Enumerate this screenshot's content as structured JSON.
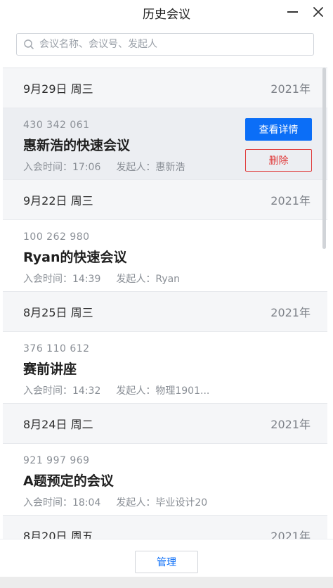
{
  "window": {
    "title": "历史会议"
  },
  "search": {
    "placeholder": "会议名称、会议号、发起人"
  },
  "groups": [
    {
      "date": "9月29日 周三",
      "year": "2021年",
      "meeting": {
        "id": "430 342 061",
        "name": "惠新浩的快速会议",
        "join_time": "入会时间：17:06",
        "host": "发起人：惠新浩"
      }
    },
    {
      "date": "9月22日 周三",
      "year": "2021年",
      "meeting": {
        "id": "100 262 980",
        "name": "Ryan的快速会议",
        "join_time": "入会时间：14:39",
        "host": "发起人：Ryan"
      }
    },
    {
      "date": "8月25日 周三",
      "year": "2021年",
      "meeting": {
        "id": "376 110 612",
        "name": "赛前讲座",
        "join_time": "入会时间：14:32",
        "host": "发起人：物理1901..."
      }
    },
    {
      "date": "8月24日 周二",
      "year": "2021年",
      "meeting": {
        "id": "921 997 969",
        "name": "A题预定的会议",
        "join_time": "入会时间：18:04",
        "host": "发起人：毕业设计20"
      }
    },
    {
      "date": "8月20日 周五",
      "year": "2021年"
    }
  ],
  "actions": {
    "details_label": "查看详情",
    "delete_label": "删除"
  },
  "footer": {
    "manage_label": "管理"
  },
  "colors": {
    "accent": "#0b6ef7",
    "danger": "#e03b3b"
  }
}
